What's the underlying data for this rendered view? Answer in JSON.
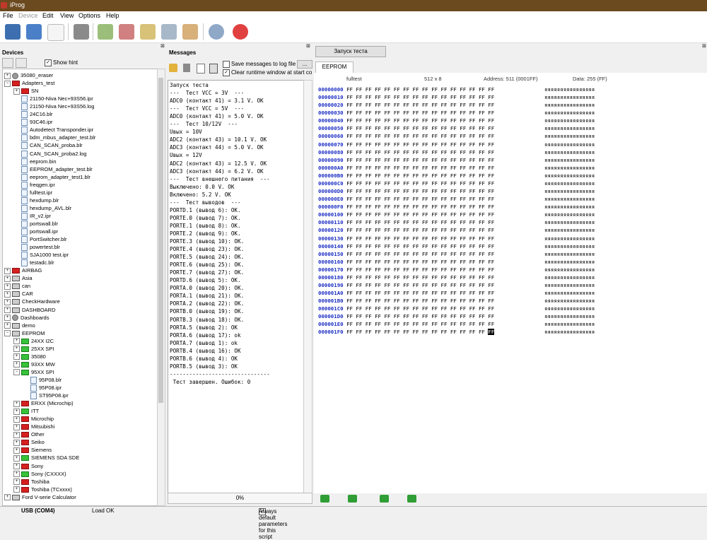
{
  "window": {
    "title": "iProg"
  },
  "menu": [
    "File",
    "Device",
    "Edit",
    "View",
    "Options",
    "Help"
  ],
  "devices": {
    "title": "Devices",
    "show_hint_label": "Show hint",
    "tree": [
      {
        "label": "35080_eraser",
        "level": 0,
        "exp": "+",
        "icon": "gear"
      },
      {
        "label": "Adapters_test",
        "level": 0,
        "exp": "−",
        "icon": "red"
      },
      {
        "label": "SN",
        "level": 1,
        "exp": "+",
        "icon": "red"
      },
      {
        "label": "21150-Niva Nec+93S56.ipr",
        "level": 1,
        "exp": "",
        "icon": "file"
      },
      {
        "label": "21150-Niva Nec+93S56.log",
        "level": 1,
        "exp": "",
        "icon": "file"
      },
      {
        "label": "24C16.blr",
        "level": 1,
        "exp": "",
        "icon": "file"
      },
      {
        "label": "93C46.ipr",
        "level": 1,
        "exp": "",
        "icon": "file"
      },
      {
        "label": "Autodetect Transponder.ipr",
        "level": 1,
        "exp": "",
        "icon": "file"
      },
      {
        "label": "bdm_mbus_adapter_test.blr",
        "level": 1,
        "exp": "",
        "icon": "file"
      },
      {
        "label": "CAN_SCAN_proba.blr",
        "level": 1,
        "exp": "",
        "icon": "file"
      },
      {
        "label": "CAN_SCAN_proba2.log",
        "level": 1,
        "exp": "",
        "icon": "file"
      },
      {
        "label": "eeprom.bin",
        "level": 1,
        "exp": "",
        "icon": "file"
      },
      {
        "label": "EEPROM_adapter_test.blr",
        "level": 1,
        "exp": "",
        "icon": "file"
      },
      {
        "label": "eeprom_adapter_test1.blr",
        "level": 1,
        "exp": "",
        "icon": "file"
      },
      {
        "label": "freqgen.ipr",
        "level": 1,
        "exp": "",
        "icon": "file"
      },
      {
        "label": "fulltest.ipr",
        "level": 1,
        "exp": "",
        "icon": "file"
      },
      {
        "label": "hexdump.blr",
        "level": 1,
        "exp": "",
        "icon": "file"
      },
      {
        "label": "hexdump_AVL.blr",
        "level": 1,
        "exp": "",
        "icon": "file"
      },
      {
        "label": "IR_v2.ipr",
        "level": 1,
        "exp": "",
        "icon": "file"
      },
      {
        "label": "portswall.blr",
        "level": 1,
        "exp": "",
        "icon": "file"
      },
      {
        "label": "portswall.ipr",
        "level": 1,
        "exp": "",
        "icon": "file"
      },
      {
        "label": "PortSwitcher.blr",
        "level": 1,
        "exp": "",
        "icon": "file"
      },
      {
        "label": "powertest.blr",
        "level": 1,
        "exp": "",
        "icon": "file"
      },
      {
        "label": "SJA1000 test.ipr",
        "level": 1,
        "exp": "",
        "icon": "file"
      },
      {
        "label": "testadc.blr",
        "level": 1,
        "exp": "",
        "icon": "file"
      },
      {
        "label": "AIRBAG",
        "level": 0,
        "exp": "+",
        "icon": "red"
      },
      {
        "label": "Asia",
        "level": 0,
        "exp": "+",
        "icon": "grey"
      },
      {
        "label": "can",
        "level": 0,
        "exp": "+",
        "icon": "grey"
      },
      {
        "label": "CAR",
        "level": 0,
        "exp": "+",
        "icon": "grey"
      },
      {
        "label": "CheckHardware",
        "level": 0,
        "exp": "+",
        "icon": "grey"
      },
      {
        "label": "DASHBOARD",
        "level": 0,
        "exp": "+",
        "icon": "grey"
      },
      {
        "label": "Dashboards",
        "level": 0,
        "exp": "+",
        "icon": "gear"
      },
      {
        "label": "demo",
        "level": 0,
        "exp": "+",
        "icon": "grey"
      },
      {
        "label": "EEPROM",
        "level": 0,
        "exp": "−",
        "icon": "grey"
      },
      {
        "label": "24XX I2C",
        "level": 1,
        "exp": "+",
        "icon": "green"
      },
      {
        "label": "25XX SPI",
        "level": 1,
        "exp": "+",
        "icon": "green"
      },
      {
        "label": "35080",
        "level": 1,
        "exp": "+",
        "icon": "green"
      },
      {
        "label": "93XX MW",
        "level": 1,
        "exp": "+",
        "icon": "green"
      },
      {
        "label": "95XX SPI",
        "level": 1,
        "exp": "−",
        "icon": "green"
      },
      {
        "label": "95P08.blr",
        "level": 2,
        "exp": "",
        "icon": "file"
      },
      {
        "label": "95P08.ipr",
        "level": 2,
        "exp": "",
        "icon": "file"
      },
      {
        "label": "ST95P08.ipr",
        "level": 2,
        "exp": "",
        "icon": "file"
      },
      {
        "label": "ERXX (Microchip)",
        "level": 1,
        "exp": "+",
        "icon": "red"
      },
      {
        "label": "ITT",
        "level": 1,
        "exp": "+",
        "icon": "green"
      },
      {
        "label": "Microchip",
        "level": 1,
        "exp": "+",
        "icon": "red"
      },
      {
        "label": "Mitsubishi",
        "level": 1,
        "exp": "+",
        "icon": "red"
      },
      {
        "label": "Other",
        "level": 1,
        "exp": "+",
        "icon": "red"
      },
      {
        "label": "Seiko",
        "level": 1,
        "exp": "+",
        "icon": "red"
      },
      {
        "label": "Siemens",
        "level": 1,
        "exp": "+",
        "icon": "red"
      },
      {
        "label": "SIEMENS SDA SDE",
        "level": 1,
        "exp": "+",
        "icon": "green"
      },
      {
        "label": "Sony",
        "level": 1,
        "exp": "+",
        "icon": "red"
      },
      {
        "label": "Sony (CXXXX)",
        "level": 1,
        "exp": "+",
        "icon": "green"
      },
      {
        "label": "Toshiba",
        "level": 1,
        "exp": "+",
        "icon": "red"
      },
      {
        "label": "Toshiba (TCxxxx)",
        "level": 1,
        "exp": "+",
        "icon": "red"
      },
      {
        "label": "Ford V-serie Calculator",
        "level": 0,
        "exp": "+",
        "icon": "grey"
      }
    ]
  },
  "messages": {
    "title": "Messages",
    "save_log_label": "Save messages to log file",
    "clear_label": "Clear runtime window at start comm",
    "lines": [
      "Запуск теста",
      "---  Тест VCC = 3V  ---",
      "ADC0 (контакт 41) = 3.1 V. OK",
      "---  Тест VCC = 5V  ---",
      "ADC0 (контакт 41) = 5.0 V. OK",
      "---  Тест 10/12V  ---",
      "Uвых = 10V",
      "ADC2 (контакт 43) = 10.1 V. OK",
      "ADC3 (контакт 44) = 5.0 V. OK",
      "Uвых = 12V",
      "ADC2 (контакт 43) = 12.5 V. OK",
      "ADC3 (контакт 44) = 6.2 V. OK",
      "---  Тест внешнего питания  ---",
      "Выключено: 0.0 V. OK",
      "Включено: 5.2 V. OK",
      "---  Тест выводов  ---",
      "PORTD.1 (вывод 6): OK.",
      "PORTE.0 (вывод 7): OK.",
      "PORTE.1 (вывод 8): OK.",
      "PORTE.2 (вывод 9): OK.",
      "PORTE.3 (вывод 10): OK.",
      "PORTE.4 (вывод 23): OK.",
      "PORTE.5 (вывод 24): OK.",
      "PORTE.6 (вывод 25): OK.",
      "PORTE.7 (вывод 27): OK.",
      "PORTD.6 (вывод 5): OK.",
      "PORTA.0 (вывод 20): OK.",
      "PORTA.1 (вывод 21): OK.",
      "PORTA.2 (вывод 22): OK.",
      "PORTB.0 (вывод 19): OK.",
      "PORTB.3 (вывод 18): OK.",
      "PORTA.5 (вывод 2): OK",
      "PORTA.6 (вывод 17): ok",
      "PORTA.7 (вывод 1): ok",
      "PORTB.4 (вывод 16): OK",
      "PORTB.6 (вывод 4): OK",
      "PORTB.5 (вывод 3): OK",
      "-------------------------------",
      " Тест завершен. Ошибок: 0"
    ],
    "progress": "0%"
  },
  "start_button": "Запуск теста",
  "hex": {
    "tab": "EEPROM",
    "file": "fulltest",
    "size": "512 x 8",
    "address": "Address: 511 (0001FF)",
    "data": "Data: 255 (FF)",
    "addresses": [
      "00000000",
      "00000010",
      "00000020",
      "00000030",
      "00000040",
      "00000050",
      "00000060",
      "00000070",
      "00000080",
      "00000090",
      "000000A0",
      "000000B0",
      "000000C0",
      "000000D0",
      "000000E0",
      "000000F0",
      "00000100",
      "00000110",
      "00000120",
      "00000130",
      "00000140",
      "00000150",
      "00000160",
      "00000170",
      "00000180",
      "00000190",
      "000001A0",
      "000001B0",
      "000001C0",
      "000001D0",
      "000001E0",
      "000001F0"
    ],
    "bytes": "FF FF FF FF FF FF FF FF FF FF FF FF FF FF FF FF",
    "last_bytes": "FF FF FF FF FF FF FF FF FF FF FF FF FF FF FF ",
    "selected_byte": "FF",
    "ascii": "яяяяяяяяяяяяяяяя"
  },
  "status": {
    "port": "USB (COM4)",
    "load": "Load OK",
    "default_params": "Always default parameters for this script"
  }
}
